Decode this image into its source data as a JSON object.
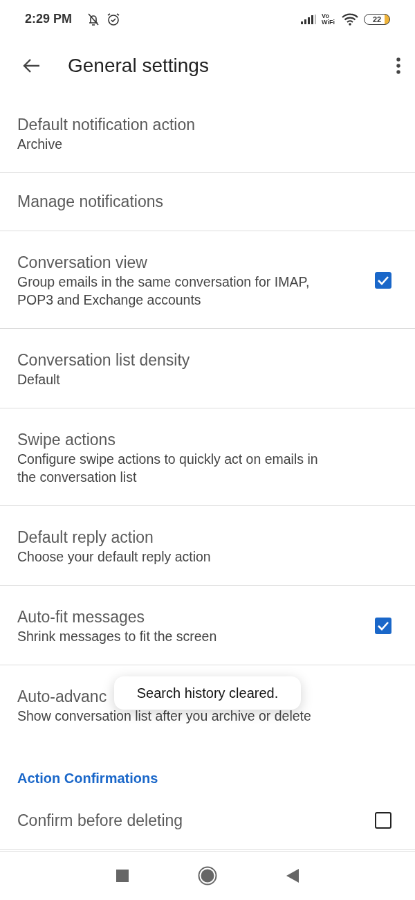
{
  "status_bar": {
    "time": "2:29 PM",
    "vowifi": [
      "Vo",
      "WiFi"
    ],
    "battery": "22"
  },
  "app_bar": {
    "title": "General settings"
  },
  "settings": [
    {
      "kind": "text",
      "title": "Default notification action",
      "subtitle": "Archive"
    },
    {
      "kind": "text",
      "title": "Manage notifications"
    },
    {
      "kind": "checkbox",
      "title": "Conversation view",
      "subtitle": "Group emails in the same conversation for IMAP, POP3 and Exchange accounts",
      "checked": true
    },
    {
      "kind": "text",
      "title": "Conversation list density",
      "subtitle": "Default"
    },
    {
      "kind": "text",
      "title": "Swipe actions",
      "subtitle": "Configure swipe actions to quickly act on emails in the conversation list"
    },
    {
      "kind": "text",
      "title": "Default reply action",
      "subtitle": "Choose your default reply action"
    },
    {
      "kind": "checkbox",
      "title": "Auto-fit messages",
      "subtitle": "Shrink messages to fit the screen",
      "checked": true
    },
    {
      "kind": "text",
      "title": "Auto-advanc",
      "subtitle": "Show conversation list after you archive or delete"
    },
    {
      "kind": "header",
      "title": "Action Confirmations"
    },
    {
      "kind": "checkbox",
      "title": "Confirm before deleting",
      "checked": false
    }
  ],
  "toast": {
    "text": "Search history cleared."
  }
}
